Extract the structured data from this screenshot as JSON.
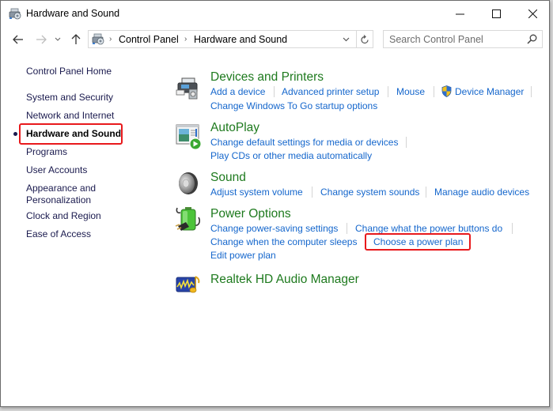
{
  "window": {
    "title": "Hardware and Sound",
    "minimize_label": "Minimize",
    "maximize_label": "Maximize",
    "close_label": "Close"
  },
  "nav": {
    "breadcrumb": [
      "Control Panel",
      "Hardware and Sound"
    ],
    "search_placeholder": "Search Control Panel"
  },
  "sidebar": {
    "items": [
      {
        "label": "Control Panel Home"
      },
      {
        "label": "System and Security"
      },
      {
        "label": "Network and Internet"
      },
      {
        "label": "Hardware and Sound",
        "current": true
      },
      {
        "label": "Programs"
      },
      {
        "label": "User Accounts"
      },
      {
        "label": "Appearance and Personalization"
      },
      {
        "label": "Clock and Region"
      },
      {
        "label": "Ease of Access"
      }
    ]
  },
  "categories": [
    {
      "title": "Devices and Printers",
      "icon": "printer-icon",
      "links": [
        "Add a device",
        "Advanced printer setup",
        "Mouse",
        "Device Manager",
        "Change Windows To Go startup options"
      ]
    },
    {
      "title": "AutoPlay",
      "icon": "autoplay-icon",
      "links": [
        "Change default settings for media or devices",
        "Play CDs or other media automatically"
      ]
    },
    {
      "title": "Sound",
      "icon": "speaker-icon",
      "links": [
        "Adjust system volume",
        "Change system sounds",
        "Manage audio devices"
      ]
    },
    {
      "title": "Power Options",
      "icon": "battery-plug-icon",
      "links": [
        "Change power-saving settings",
        "Change what the power buttons do",
        "Change when the computer sleeps",
        "Choose a power plan",
        "Edit power plan"
      ]
    },
    {
      "title": "Realtek HD Audio Manager",
      "icon": "realtek-audio-icon",
      "links": []
    }
  ],
  "highlights": {
    "color": "#e8191c",
    "targets": [
      "Hardware and Sound",
      "Choose a power plan"
    ]
  }
}
